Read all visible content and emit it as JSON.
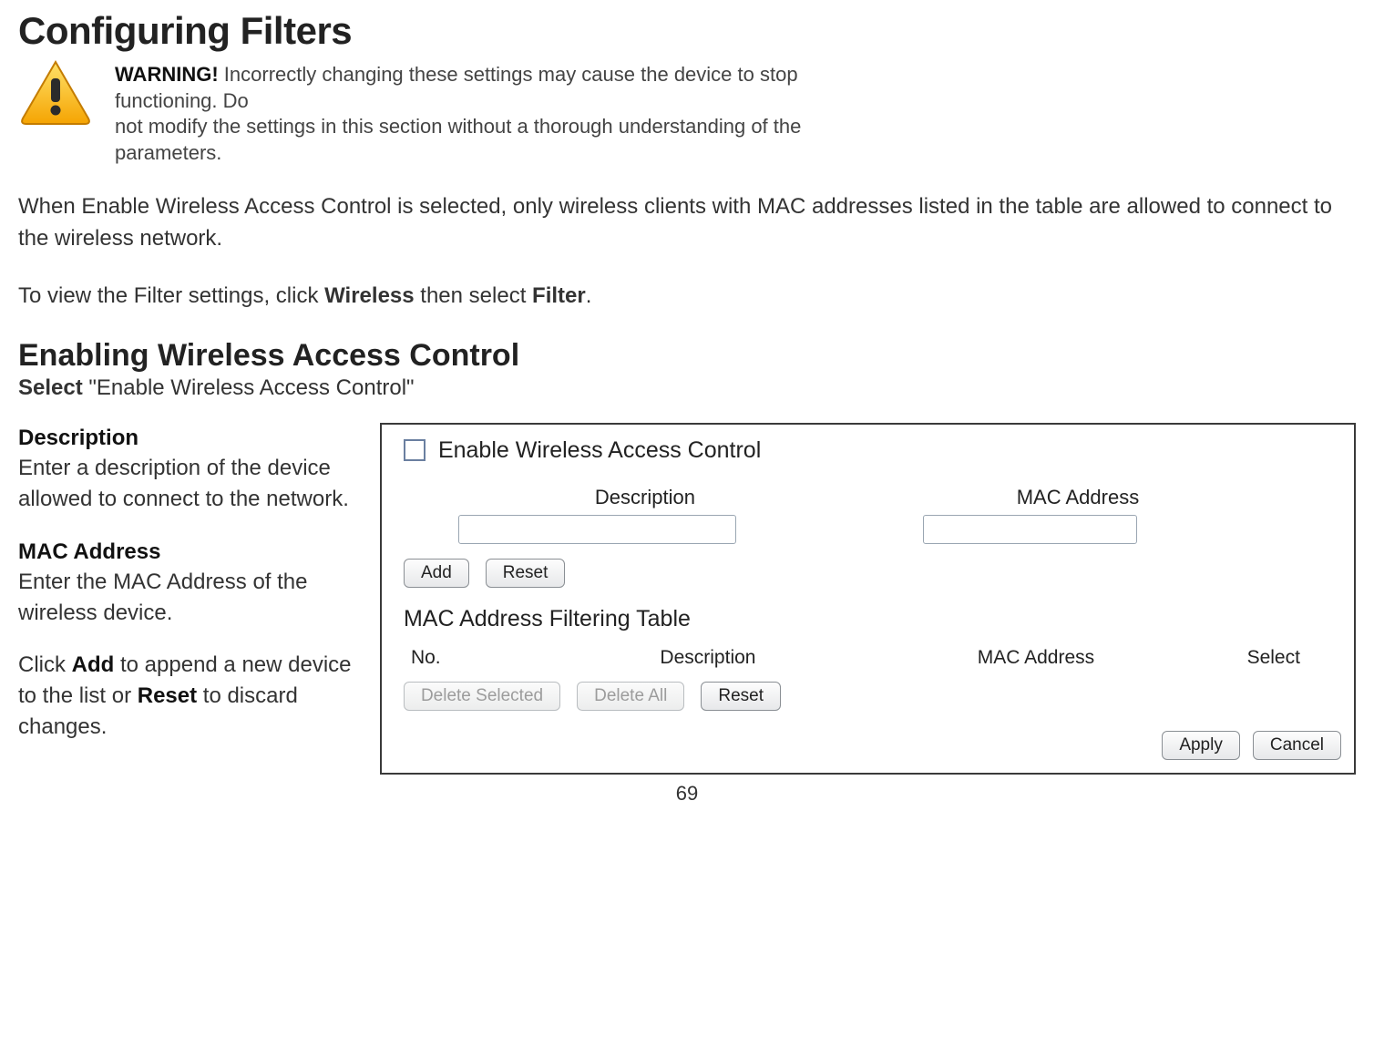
{
  "doc": {
    "h1": "Configuring Filters",
    "warning_bold": "WARNING!",
    "warning_text_line1": "Incorrectly changing these settings may cause the device to stop functioning. Do",
    "warning_text_line2": "not modify the settings in this section without a thorough understanding of the parameters.",
    "para1": "When Enable Wireless Access Control is selected, only wireless clients with MAC addresses listed in the table are allowed to connect to the wireless network.",
    "para2_pre": "To view the Filter settings, click ",
    "para2_b1": "Wireless",
    "para2_mid": " then select ",
    "para2_b2": "Filter",
    "para2_post": ".",
    "h2": "Enabling Wireless Access Control",
    "sub_select": "Select",
    "sub_quote": " \"Enable Wireless Access Control\"",
    "left": {
      "desc_h": "Description",
      "desc_b": "Enter a description of the device allowed to connect to the network.",
      "mac_h": "MAC Address",
      "mac_b": "Enter the MAC Address of the wireless device.",
      "action_pre": "Click ",
      "action_b1": "Add",
      "action_mid": " to append a new device to the list or ",
      "action_b2": "Reset",
      "action_post": " to discard changes."
    },
    "page": "69"
  },
  "panel": {
    "checkbox_label": "Enable Wireless Access Control",
    "desc_label": "Description",
    "mac_label": "MAC Address",
    "desc_value": "",
    "mac_value": "",
    "btn_add": "Add",
    "btn_reset": "Reset",
    "table_title": "MAC Address Filtering Table",
    "col_no": "No.",
    "col_desc": "Description",
    "col_mac": "MAC Address",
    "col_select": "Select",
    "btn_delete_selected": "Delete Selected",
    "btn_delete_all": "Delete All",
    "btn_reset2": "Reset",
    "btn_apply": "Apply",
    "btn_cancel": "Cancel"
  }
}
